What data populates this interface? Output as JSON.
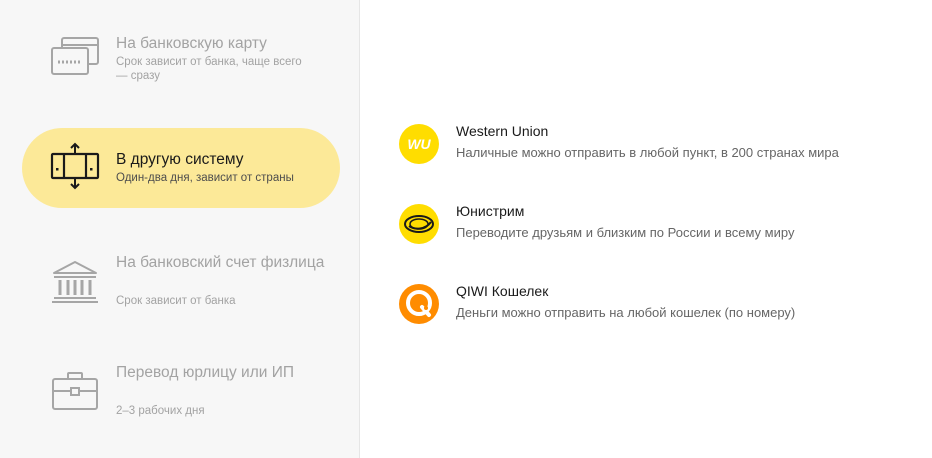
{
  "methods": [
    {
      "title": "На банковскую карту",
      "subtitle": "Срок зависит от банка, чаще всего — сразу",
      "icon": "bank-card-icon",
      "active": false
    },
    {
      "title": "В другую систему",
      "subtitle": "Один-два дня, зависит от страны",
      "icon": "transfer-system-icon",
      "active": true
    },
    {
      "title": "На банковский счет физлица",
      "subtitle": "Срок зависит от банка",
      "icon": "bank-building-icon",
      "active": false
    },
    {
      "title": "Перевод юрлицу или ИП",
      "subtitle": "2–3 рабочих дня",
      "icon": "briefcase-icon",
      "active": false
    }
  ],
  "systems": [
    {
      "name": "Western Union",
      "description": "Наличные можно отправить в любой пункт, в 200 странах мира",
      "logo_text": "WU",
      "logo_color": "#ffdd00",
      "icon": "western-union-logo-icon"
    },
    {
      "name": "Юнистрим",
      "description": "Переводите друзьям и близким по России и всему миру",
      "logo_color": "#ffdd00",
      "icon": "unistream-logo-icon"
    },
    {
      "name": "QIWI Кошелек",
      "description": "Деньги можно отправить на любой кошелек (по номеру)",
      "logo_color": "#ff8c00",
      "icon": "qiwi-logo-icon"
    }
  ],
  "colors": {
    "active_bg": "#fce998",
    "muted_text": "#a3a3a3",
    "icon_muted": "#a6a6a6"
  }
}
